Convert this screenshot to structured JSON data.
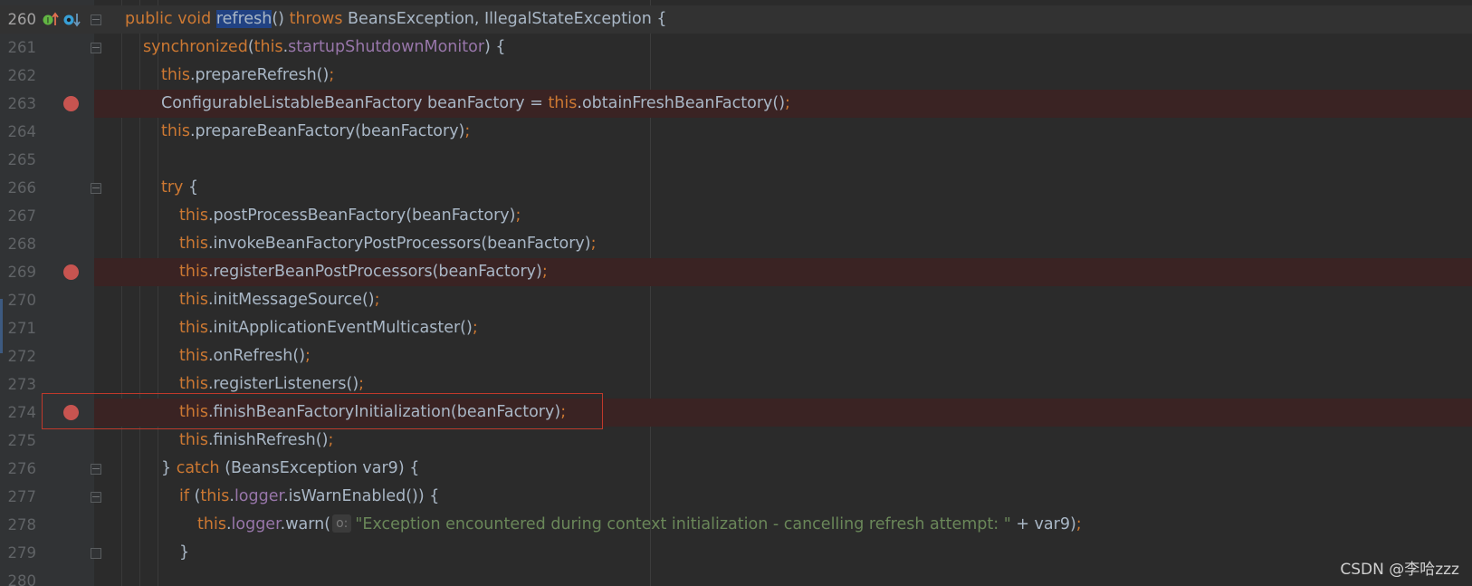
{
  "editor": {
    "lines": [
      {
        "num": "260",
        "caret": true
      },
      {
        "num": "261"
      },
      {
        "num": "262"
      },
      {
        "num": "263",
        "breakpoint": true
      },
      {
        "num": "264"
      },
      {
        "num": "265"
      },
      {
        "num": "266"
      },
      {
        "num": "267"
      },
      {
        "num": "268"
      },
      {
        "num": "269",
        "breakpoint": true
      },
      {
        "num": "270"
      },
      {
        "num": "271"
      },
      {
        "num": "272"
      },
      {
        "num": "273"
      },
      {
        "num": "274",
        "breakpoint": true
      },
      {
        "num": "275"
      },
      {
        "num": "276"
      },
      {
        "num": "277"
      },
      {
        "num": "278"
      },
      {
        "num": "279"
      },
      {
        "num": "280"
      }
    ],
    "tokens": {
      "l260": {
        "kw1": "public void ",
        "sel": "refresh",
        "p1": "() ",
        "kw2": "throws ",
        "rest": "BeansException, IllegalStateException {"
      },
      "l261": {
        "kw1": "synchronized",
        "p1": "(",
        "kw2": "this",
        "p2": ".",
        "fld": "startupShutdownMonitor",
        "rest": ") {"
      },
      "l262": {
        "kw1": "this",
        "rest": ".prepareRefresh()",
        "semi": ";"
      },
      "l263": {
        "pre": "ConfigurableListableBeanFactory beanFactory = ",
        "kw1": "this",
        "rest": ".obtainFreshBeanFactory()",
        "semi": ";"
      },
      "l264": {
        "kw1": "this",
        "rest": ".prepareBeanFactory(beanFactory)",
        "semi": ";"
      },
      "l266": {
        "kw1": "try ",
        "rest": "{"
      },
      "l267": {
        "kw1": "this",
        "rest": ".postProcessBeanFactory(beanFactory)",
        "semi": ";"
      },
      "l268": {
        "kw1": "this",
        "rest": ".invokeBeanFactoryPostProcessors(beanFactory)",
        "semi": ";"
      },
      "l269": {
        "kw1": "this",
        "rest": ".registerBeanPostProcessors(beanFactory)",
        "semi": ";"
      },
      "l270": {
        "kw1": "this",
        "rest": ".initMessageSource()",
        "semi": ";"
      },
      "l271": {
        "kw1": "this",
        "rest": ".initApplicationEventMulticaster()",
        "semi": ";"
      },
      "l272": {
        "kw1": "this",
        "rest": ".onRefresh()",
        "semi": ";"
      },
      "l273": {
        "kw1": "this",
        "rest": ".registerListeners()",
        "semi": ";"
      },
      "l274": {
        "kw1": "this",
        "rest": ".finishBeanFactoryInitialization(beanFactory)",
        "semi": ";"
      },
      "l275": {
        "kw1": "this",
        "rest": ".finishRefresh()",
        "semi": ";"
      },
      "l276": {
        "pre": "} ",
        "kw1": "catch ",
        "rest": "(BeansException var9) {"
      },
      "l277": {
        "kw1": "if ",
        "p1": "(",
        "kw2": "this",
        "p2": ".",
        "fld": "logger",
        "rest": ".isWarnEnabled()) {"
      },
      "l278": {
        "kw1": "this",
        "p1": ".",
        "fld": "logger",
        "p2": ".warn(",
        "hint": "o:",
        "str": "\"Exception encountered during context initialization - cancelling refresh attempt: \"",
        "rest": " + var9)",
        "semi": ";"
      },
      "l279": {
        "rest": "}"
      }
    }
  },
  "gutter_icons": {
    "implements_icon": "implementing-method-icon",
    "overrides_icon": "overriding-method-icon"
  },
  "colors": {
    "keyword": "#cc7832",
    "field": "#9876aa",
    "string": "#6a8759",
    "text": "#a9b7c6",
    "breakpoint": "#c75450",
    "highlight_box": "#c0392b"
  },
  "watermark": "CSDN @李哈zzz"
}
